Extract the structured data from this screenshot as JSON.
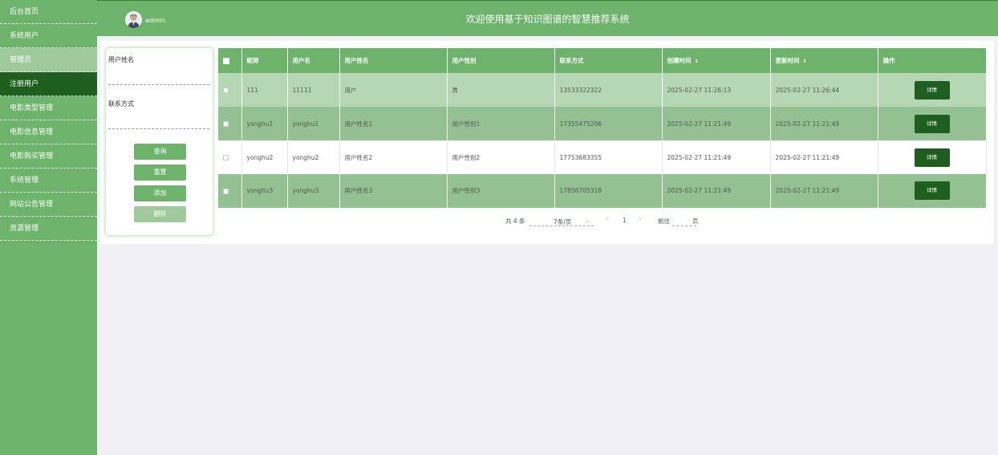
{
  "sidebar": {
    "items": [
      {
        "label": "后台首页"
      },
      {
        "label": "系统用户"
      },
      {
        "label": "管理员"
      },
      {
        "label": "注册用户"
      },
      {
        "label": "电影类型管理"
      },
      {
        "label": "电影信息管理"
      },
      {
        "label": "电影购买管理"
      },
      {
        "label": "系统管理"
      },
      {
        "label": "网站公告管理"
      },
      {
        "label": "资源管理"
      }
    ]
  },
  "header": {
    "user": "admin",
    "title": "欢迎使用基于知识图谱的智慧推荐系统"
  },
  "search": {
    "name_label": "用户姓名",
    "contact_label": "联系方式",
    "query": "查询",
    "reset": "重置",
    "add": "添加",
    "delete": "删除"
  },
  "table": {
    "headers": [
      "昵称",
      "用户名",
      "用户姓名",
      "用户性别",
      "联系方式",
      "创建时间",
      "更新时间",
      "操作"
    ],
    "rows": [
      {
        "nickname": "111",
        "username": "11111",
        "name": "用户",
        "gender": "男",
        "contact": "13533322322",
        "created": "2025-02-27 11:26:13",
        "updated": "2025-02-27 11:26:44",
        "action": "详情"
      },
      {
        "nickname": "yonghu1",
        "username": "yonghu1",
        "name": "用户姓名1",
        "gender": "用户性别1",
        "contact": "17355475206",
        "created": "2025-02-27 11:21:49",
        "updated": "2025-02-27 11:21:49",
        "action": "详情"
      },
      {
        "nickname": "yonghu2",
        "username": "yonghu2",
        "name": "用户姓名2",
        "gender": "用户性别2",
        "contact": "17753683355",
        "created": "2025-02-27 11:21:49",
        "updated": "2025-02-27 11:21:49",
        "action": "详情"
      },
      {
        "nickname": "yonghu3",
        "username": "yonghu3",
        "name": "用户姓名3",
        "gender": "用户性别3",
        "contact": "17856705318",
        "created": "2025-02-27 11:21:49",
        "updated": "2025-02-27 11:21:49",
        "action": "详情"
      }
    ]
  },
  "pagination": {
    "total": "共 4 条",
    "page_size": "7条/页",
    "prev": "‹",
    "current_page": "1",
    "next": "›",
    "goto_prefix": "前往",
    "goto_suffix": "页"
  },
  "colors": {
    "primary": "#6db36b",
    "dark": "#1e5e1e",
    "row_light": "#b6d7b4",
    "row_mid": "#93c191"
  },
  "icons": {
    "sort": "sort-caret-icon",
    "dropdown": "chevron-down-icon",
    "avatar": "user-avatar"
  }
}
